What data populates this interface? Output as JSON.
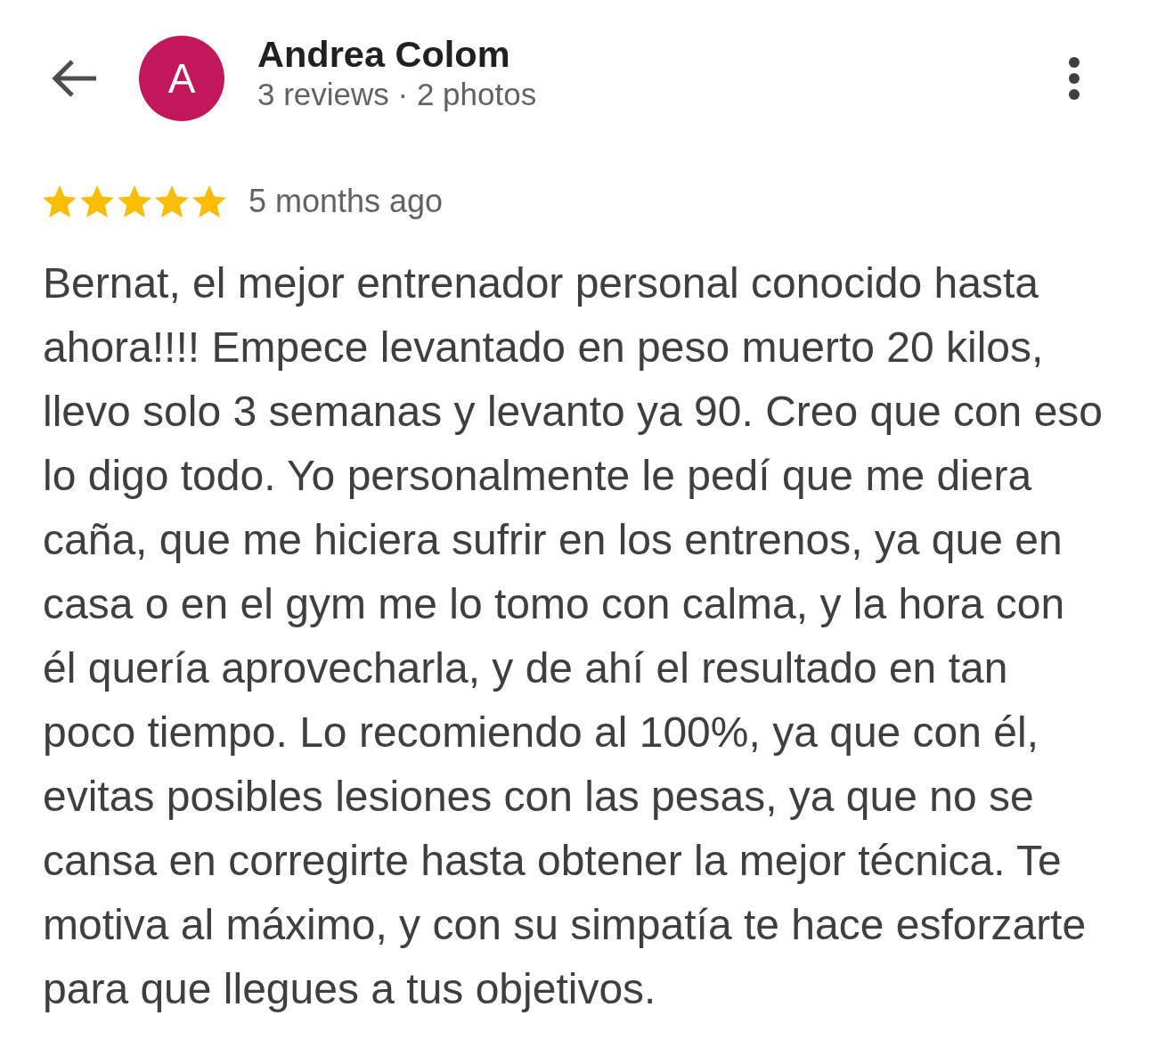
{
  "header": {
    "avatar_letter": "A",
    "name": "Andrea Colom",
    "stats": "3 reviews · 2 photos"
  },
  "review": {
    "stars": 5,
    "time": "5 months ago",
    "text": "Bernat, el mejor entrenador personal conocido hasta ahora!!!! Empece levantado en peso muerto 20 kilos, llevo solo 3 semanas y levanto ya 90. Creo que con eso lo digo todo. Yo personalmente le pedí que me diera caña, que me hiciera sufrir en los entrenos, ya que en casa o en el gym me lo tomo con calma, y la hora con él quería aprovecharla, y de ahí el resultado en tan poco tiempo. Lo recomiendo al 100%, ya que con él, evitas posibles lesiones con las pesas, ya que no se cansa en corregirte hasta obtener la mejor técnica. Te motiva al máximo, y con su simpatía te hace esforzarte para que llegues a tus objetivos."
  }
}
